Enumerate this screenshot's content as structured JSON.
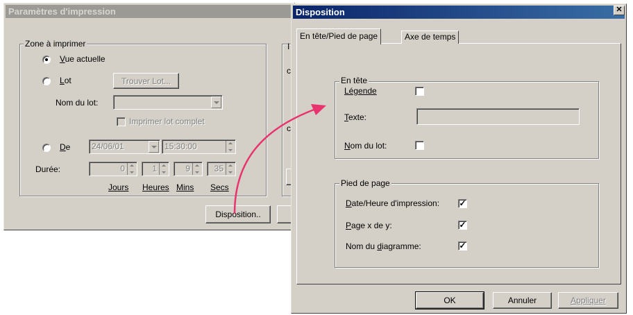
{
  "background_window": {
    "title": "Paramètres d'impression",
    "zone_group": {
      "legend": "Zone à imprimer",
      "radio_vue_actuelle": "Vue actuelle",
      "radio_lot": "Lot",
      "trouver_lot_button": "Trouver Lot...",
      "nom_du_lot_label": "Nom du lot:",
      "imprimer_lot_complet": "Imprimer lot complet",
      "radio_de": "De",
      "date_value": "24/06/01",
      "time_value": "15:30:00",
      "duree_label": "Durée:",
      "duree_jours": "0",
      "duree_heures": "1",
      "duree_mins": "9",
      "duree_secs": "35",
      "unit_jours": "Jours",
      "unit_heures": "Heures",
      "unit_mins": "Mins",
      "unit_secs": "Secs"
    },
    "disposition_button": "Disposition..",
    "side_glyphs": [
      "I",
      "c",
      "c"
    ]
  },
  "dialog": {
    "title": "Disposition",
    "close_glyph": "✕",
    "tabs": [
      "En tête/Pied de page",
      "Axe de temps"
    ],
    "active_tab": 0,
    "header_group": {
      "legend": "En tête",
      "legende_label": "Légende",
      "legende_checked": false,
      "texte_label": "Texte:",
      "texte_value": "",
      "nom_du_lot_label": "Nom du lot:",
      "nom_du_lot_checked": false
    },
    "footer_group": {
      "legend": "Pied de page",
      "date_heure_label": "Date/Heure d'impression:",
      "date_heure_checked": true,
      "page_label": "Page x de y:",
      "page_checked": true,
      "nom_diagramme_label": "Nom du diagramme:",
      "nom_diagramme_checked": true,
      "check_glyph": "✓"
    },
    "buttons": {
      "ok": "OK",
      "annuler": "Annuler",
      "appliquer": "Appliquer"
    }
  },
  "colors": {
    "arrow": "#e8336e",
    "active_title": "#0a246a",
    "face": "#d4d0c8"
  }
}
